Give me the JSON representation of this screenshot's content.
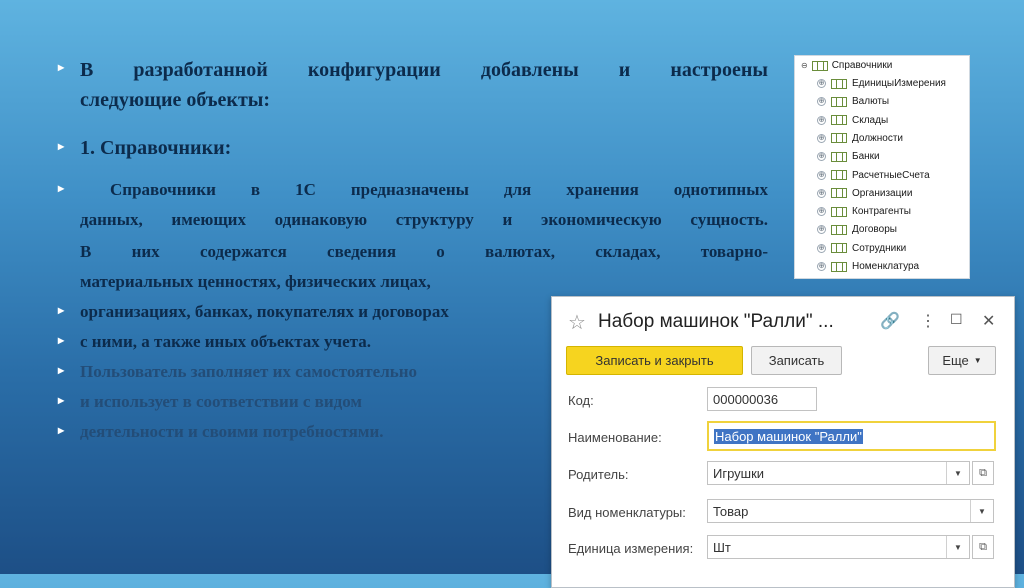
{
  "slide": {
    "lines": [
      "В разработанной конфигурации добавлены и настроены",
      "следующие объекты:",
      "1. Справочники:",
      "Справочники в 1С предназначены для хранения однотипных",
      "данных, имеющих одинаковую структуру и экономическую сущность.",
      "В них содержатся сведения о валютах, складах, товарно-",
      "материальных ценностях, физических лицах,",
      "организациях, банках, покупателях и договорах",
      "с ними, а также иных объектах учета.",
      "Пользователь заполняет их самостоятельно",
      "и использует в соответствии с видом",
      "деятельности и своими потребностями."
    ],
    "bullet_glyph": "▸"
  },
  "tree": {
    "root": "Справочники",
    "expander": "⊕",
    "items": [
      "ЕдиницыИзмерения",
      "Валюты",
      "Склады",
      "Должности",
      "Банки",
      "РасчетныеСчета",
      "Организации",
      "Контрагенты",
      "Договоры",
      "Сотрудники",
      "Номенклатура"
    ]
  },
  "form": {
    "title": "Набор машинок \"Ралли\" ...",
    "buttons": {
      "save_close": "Записать и закрыть",
      "save": "Записать",
      "more": "Еще"
    },
    "fields": {
      "code_label": "Код:",
      "code_value": "000000036",
      "name_label": "Наименование:",
      "name_value": "Набор машинок \"Ралли\"",
      "parent_label": "Родитель:",
      "parent_value": "Игрушки",
      "kind_label": "Вид номенклатуры:",
      "kind_value": "Товар",
      "unit_label": "Единица измерения:",
      "unit_value": "Шт"
    }
  },
  "colors": {
    "primary_button": "#f6d41f",
    "selection": "#3f74c4",
    "slide_text": "#0c2b4c"
  }
}
